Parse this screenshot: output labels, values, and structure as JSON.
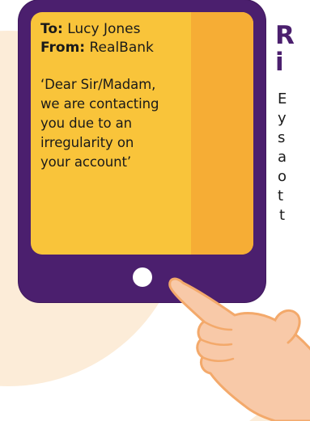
{
  "email": {
    "to_label": "To:",
    "to_value": " Lucy Jones",
    "from_label": "From:",
    "from_value": " RealBank",
    "body_lines": [
      "‘Dear Sir/Madam,",
      "we are contacting",
      "you due to an",
      "irregularity on",
      "your account’"
    ]
  },
  "headline_lines": [
    "R",
    "i"
  ],
  "body_fragment_lines": [
    "E",
    "y",
    "s",
    "a",
    "o",
    "t",
    "t"
  ],
  "colors": {
    "tablet_frame": "#4b1f6e",
    "screen": "#f9c43a",
    "screen_shade": "#f6ad35",
    "headline": "#4b1f6e",
    "background_circle": "#fcecd8",
    "hand_fill": "#f8c9a8",
    "hand_stroke": "#f3a96b"
  },
  "icons": {
    "home_button": "tablet-home-button-icon",
    "hand": "pointing-hand-icon"
  }
}
